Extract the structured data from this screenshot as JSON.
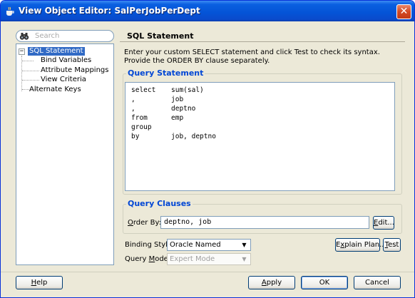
{
  "window": {
    "title": "View Object Editor: SalPerJobPerDept",
    "close_glyph": "✕"
  },
  "nav": {
    "search_placeholder": "Search",
    "tree": {
      "expand_glyph": "−",
      "items": [
        {
          "label": "SQL Statement",
          "selected": true
        },
        {
          "label": "Bind Variables"
        },
        {
          "label": "Attribute Mappings"
        },
        {
          "label": "View Criteria"
        },
        {
          "label": "Alternate Keys"
        }
      ]
    }
  },
  "panel": {
    "title": "SQL Statement",
    "description": "Enter your custom SELECT statement and click Test to check its syntax.  Provide the ORDER BY clause separately.",
    "query_statement": {
      "legend": "Query Statement",
      "lines": [
        {
          "kw": "select",
          "rest": "sum(sal)"
        },
        {
          "kw": ",",
          "rest": "job"
        },
        {
          "kw": ",",
          "rest": "deptno"
        },
        {
          "kw": "from",
          "rest": "emp"
        },
        {
          "kw": "group",
          "rest": ""
        },
        {
          "kw": "by",
          "rest": "job, deptno"
        }
      ]
    },
    "query_clauses": {
      "legend": "Query Clauses",
      "order_by_label_u": "O",
      "order_by_label_rest": "rder By:",
      "order_by_value": "deptno, job",
      "edit_button_u": "E",
      "edit_button_rest": "dit..."
    },
    "binding_style": {
      "label_pre": "Binding Style:",
      "value": "Oracle Named"
    },
    "query_mode": {
      "label_pre": "Query ",
      "label_u": "M",
      "label_post": "ode:",
      "value": "Expert Mode"
    },
    "explain_button_pre": "E",
    "explain_button_u": "x",
    "explain_button_post": "plain Plan...",
    "test_button_u": "T",
    "test_button_rest": "est"
  },
  "footer": {
    "help_u": "H",
    "help_rest": "elp",
    "apply_u": "A",
    "apply_rest": "pply",
    "ok": "OK",
    "cancel": "Cancel"
  },
  "icons": {
    "title_icon": "oracle-coffee-icon",
    "search_icon": "binoculars-icon",
    "dropdown_icon": "chevron-down-icon"
  }
}
